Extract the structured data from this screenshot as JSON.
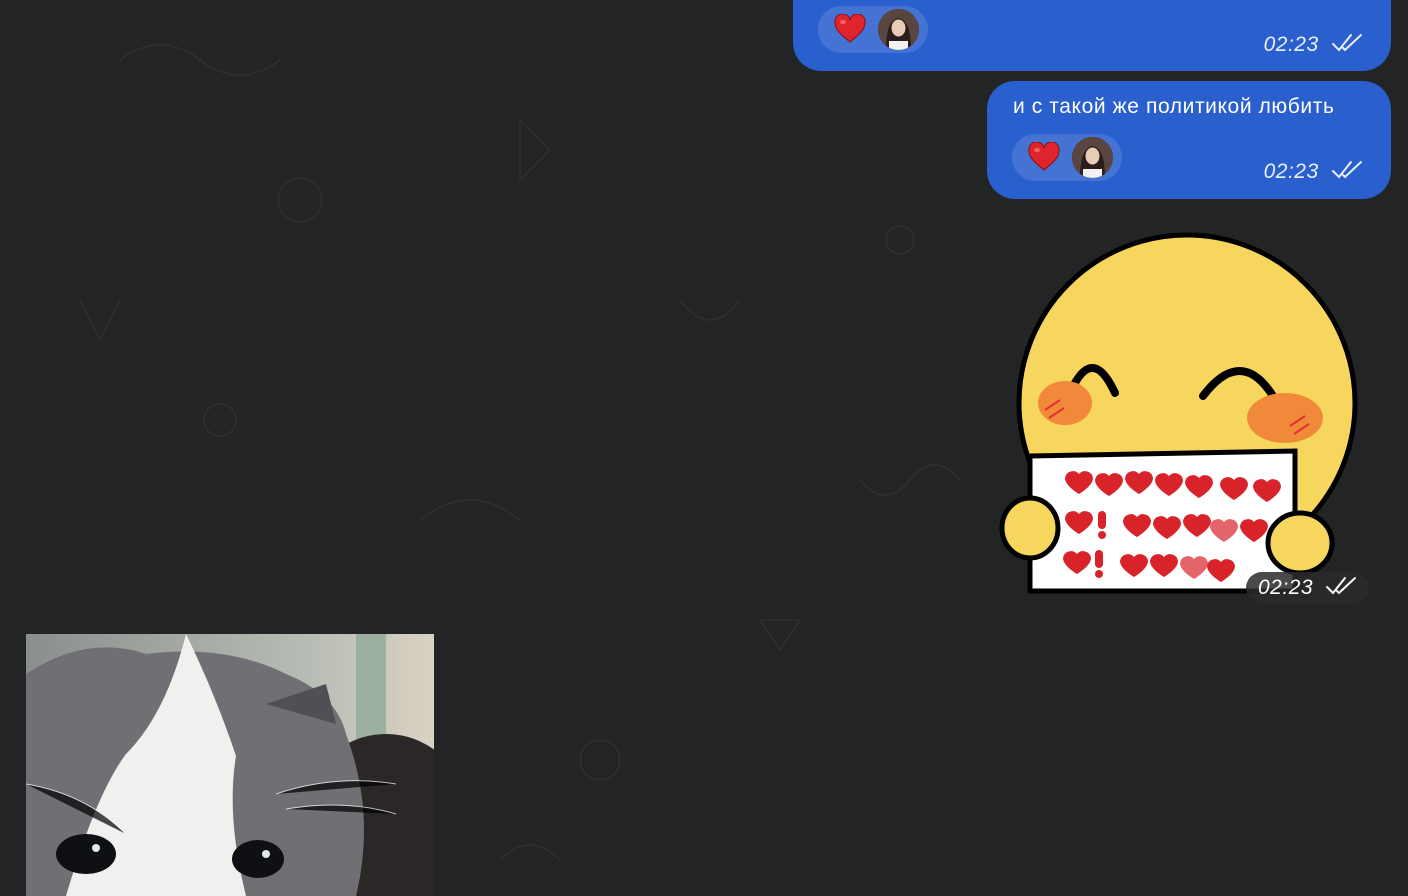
{
  "messages": [
    {
      "id": "top",
      "text": "",
      "time": "02:23",
      "reaction": {
        "emoji": "heart-icon",
        "reactor": "avatar"
      }
    },
    {
      "id": "second",
      "text": "и с такой же политикой любить",
      "time": "02:23",
      "reaction": {
        "emoji": "heart-icon",
        "reactor": "avatar"
      }
    }
  ],
  "sticker": {
    "time": "02:23",
    "description_icon": "smiley-sticker-icon"
  },
  "photo": {
    "icon": "kitten-photo"
  },
  "colors": {
    "background": "#222426",
    "outgoing_bubble": "#2a5fce",
    "heart": "#e0242b"
  }
}
